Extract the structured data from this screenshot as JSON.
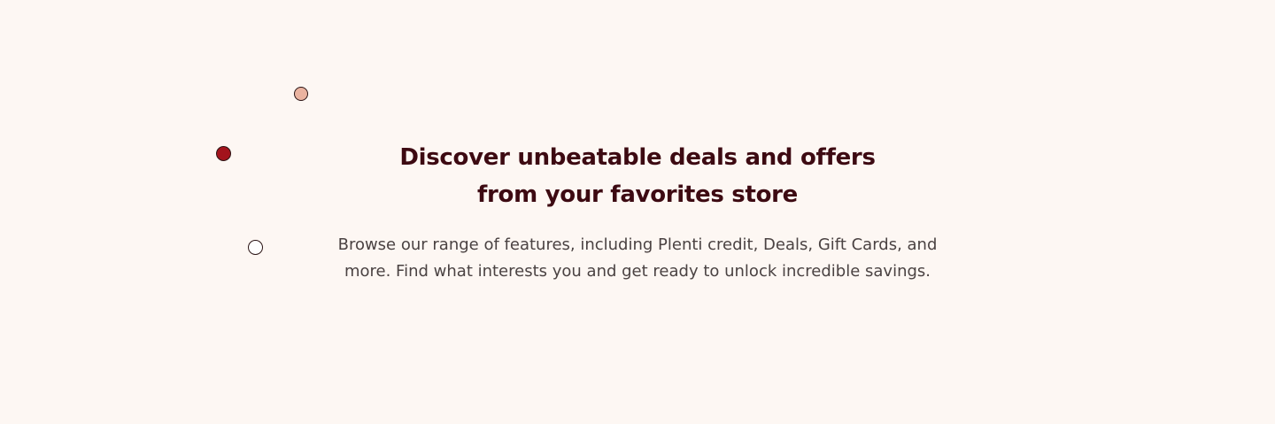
{
  "hero": {
    "heading_line1": "Discover unbeatable deals and offers",
    "heading_line2": "from your favorites store",
    "description_line1": "Browse our range of features, including Plenti credit, Deals, Gift Cards, and",
    "description_line2": "more. Find what interests you and get ready to unlock incredible savings."
  },
  "decorations": {
    "dot_colors": [
      "#eab3a0",
      "#a3131c",
      "#ffffff"
    ]
  },
  "colors": {
    "background": "#fdf7f3",
    "heading": "#3d0a12",
    "body_text": "#4a4242"
  }
}
